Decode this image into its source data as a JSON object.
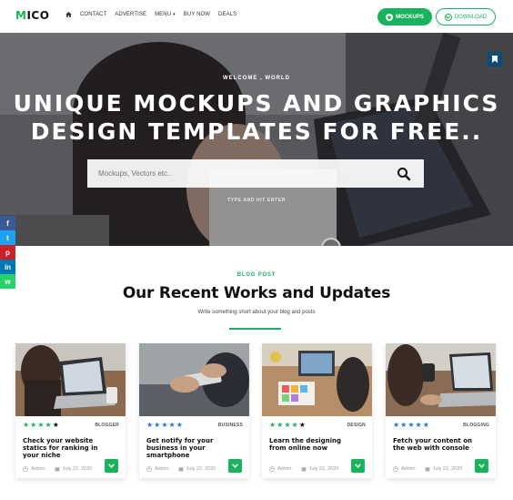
{
  "logo": {
    "first": "M",
    "rest": "ICO"
  },
  "nav": {
    "home_icon": "home-icon",
    "items": [
      {
        "label": "CONTACT"
      },
      {
        "label": "ADVERTISE"
      },
      {
        "label": "MENU"
      },
      {
        "label": "BUY NOW"
      },
      {
        "label": "DEALS"
      }
    ],
    "menu_caret": "▾"
  },
  "header_buttons": {
    "mockups": {
      "label": "MOCKUPS",
      "icon": "star-icon"
    },
    "download": {
      "label": "DOWNLOAD",
      "icon": "chevron-down-circle-icon"
    }
  },
  "hero": {
    "subtitle": "WELCOME , WORLD",
    "title_line1": "UNIQUE MOCKUPS AND GRAPHICS",
    "title_line2": "DESIGN TEMPLATES FOR FREE..",
    "search_placeholder": "Mockups, Vectors etc..",
    "search_value": "",
    "hint": "TYPE AND HIT ENTER",
    "bookmark_icon": "bookmark-icon"
  },
  "social": [
    {
      "name": "facebook",
      "glyph": "f",
      "color": "#3b5998"
    },
    {
      "name": "twitter",
      "glyph": "t",
      "color": "#1da1f2"
    },
    {
      "name": "pinterest",
      "glyph": "p",
      "color": "#cb2027"
    },
    {
      "name": "linkedin",
      "glyph": "in",
      "color": "#0077b5"
    },
    {
      "name": "whatsapp",
      "glyph": "w",
      "color": "#25d366"
    }
  ],
  "section": {
    "tag": "BLOG POST",
    "title": "Our Recent Works and Updates",
    "description": "Write something short about your blog and posts"
  },
  "colors": {
    "accent": "#19b35e",
    "star_filled": "#19b35e",
    "star_empty": "#111111"
  },
  "cards": [
    {
      "rating": 4,
      "category": "BLOGGER",
      "title": "Check your website statics for ranking in your niche",
      "author": "Admin",
      "date": "July 22, 2020"
    },
    {
      "rating": 5,
      "category": "BUSINESS",
      "title": "Get notify for your business in your smartphone",
      "author": "Admin",
      "date": "July 22, 2020"
    },
    {
      "rating": 4,
      "category": "DESIGN",
      "title": "Learn the designing from online now",
      "author": "Admin",
      "date": "July 22, 2020"
    },
    {
      "rating": 5,
      "category": "BLOGGING",
      "title": "Fetch your content on the web with console",
      "author": "Admin",
      "date": "July 22, 2020"
    }
  ]
}
